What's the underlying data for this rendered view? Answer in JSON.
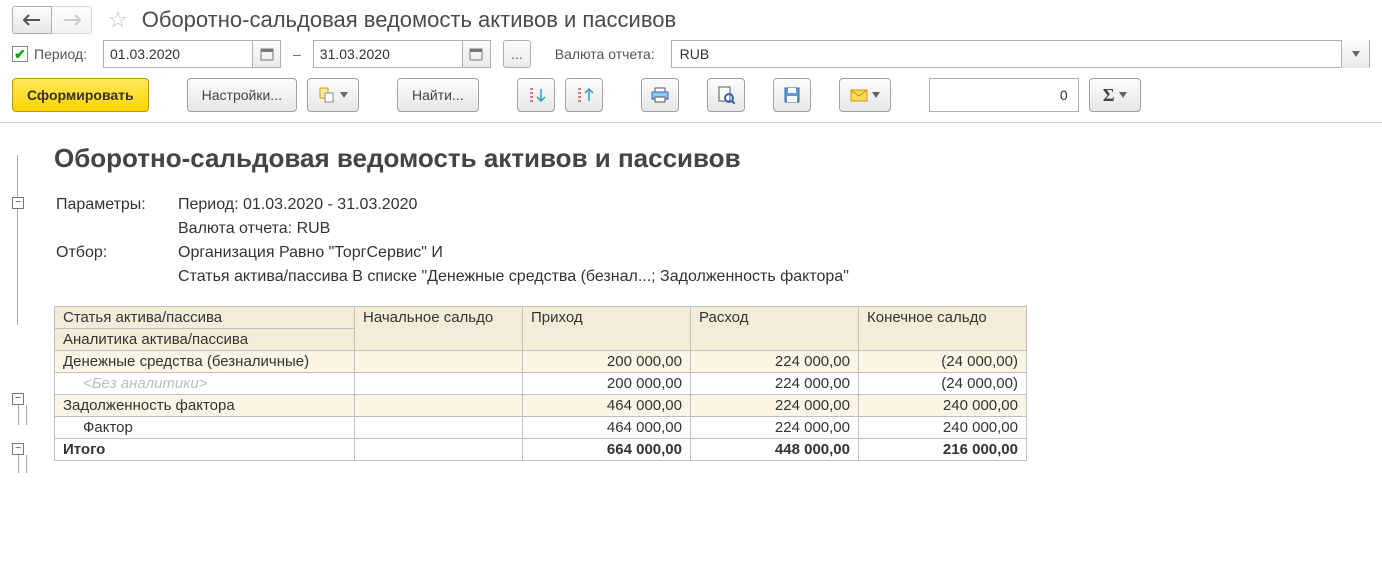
{
  "header": {
    "title": "Оборотно-сальдовая ведомость активов и пассивов"
  },
  "filters": {
    "period_label": "Период:",
    "date_from": "01.03.2020",
    "date_to": "31.03.2020",
    "dash": "–",
    "ellipsis": "...",
    "currency_label": "Валюта отчета:",
    "currency_value": "RUB"
  },
  "actions": {
    "generate": "Сформировать",
    "settings": "Настройки...",
    "find": "Найти...",
    "number_value": "0"
  },
  "report": {
    "title": "Оборотно-сальдовая ведомость активов и пассивов",
    "params_label": "Параметры:",
    "param_period": "Период: 01.03.2020 - 31.03.2020",
    "param_currency": "Валюта отчета: RUB",
    "filter_label": "Отбор:",
    "filter_line1": "Организация Равно \"ТоргСервис\" И",
    "filter_line2": "Статья актива/пассива В списке \"Денежные средства (безнал...; Задолженность фактора\"",
    "columns": {
      "c1a": "Статья актива/пассива",
      "c1b": "Аналитика актива/пассива",
      "c2": "Начальное сальдо",
      "c3": "Приход",
      "c4": "Расход",
      "c5": "Конечное сальдо"
    },
    "rows": [
      {
        "label": "Денежные средства (безналичные)",
        "in": "200 000,00",
        "out": "224 000,00",
        "end": "(24 000,00)",
        "beige": true
      },
      {
        "label": "<Без аналитики>",
        "indent": 1,
        "muted": true,
        "in": "200 000,00",
        "out": "224 000,00",
        "end": "(24 000,00)"
      },
      {
        "label": "Задолженность фактора",
        "in": "464 000,00",
        "out": "224 000,00",
        "end": "240 000,00",
        "beige": true
      },
      {
        "label": "Фактор",
        "indent": 1,
        "in": "464 000,00",
        "out": "224 000,00",
        "end": "240 000,00"
      }
    ],
    "total": {
      "label": "Итого",
      "in": "664 000,00",
      "out": "448 000,00",
      "end": "216 000,00"
    }
  }
}
